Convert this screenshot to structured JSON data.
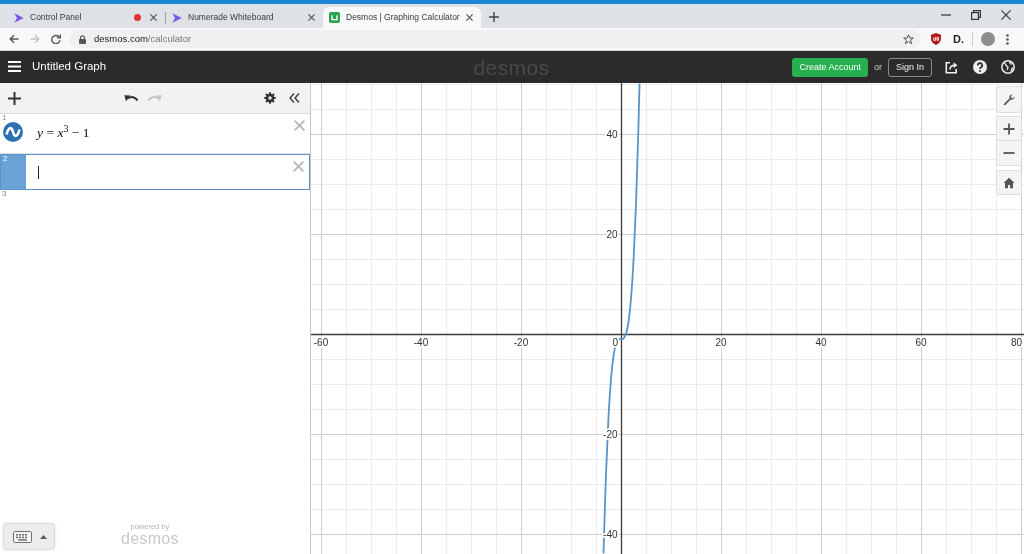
{
  "browser": {
    "tabs": [
      {
        "title": "Control Panel",
        "recording": true,
        "selected": false
      },
      {
        "title": "Numerade Whiteboard",
        "recording": false,
        "selected": false
      },
      {
        "title": "Desmos | Graphing Calculator",
        "recording": false,
        "selected": true
      }
    ],
    "nav_buttons": [
      {
        "kind": "back",
        "disabled": false
      },
      {
        "kind": "forward",
        "disabled": true
      },
      {
        "kind": "reload",
        "disabled": false
      }
    ],
    "address": {
      "host": "desmos.com",
      "path": "/calculator"
    },
    "extension_label": "D."
  },
  "header": {
    "graph_title": "Untitled Graph",
    "logo": "desmos",
    "create_account": "Create Account",
    "separator": "or",
    "sign_in": "Sign In"
  },
  "expression_list": {
    "history_buttons": [
      {
        "kind": "undo",
        "disabled": false
      },
      {
        "kind": "redo",
        "disabled": true
      }
    ],
    "items": [
      {
        "kind": "expression",
        "index": "1",
        "formula": "*y* = *x*$^{3}$ − 1",
        "color": "#2d70b3",
        "selected": false
      },
      {
        "kind": "expression",
        "index": "2",
        "selected": true
      },
      {
        "kind": "new",
        "index": "3",
        "selected": false
      }
    ],
    "footer": {
      "caption": "powered by",
      "logo": "desmos"
    }
  },
  "graph": {
    "chart_data": {
      "type": "line",
      "grid": true,
      "xlim": [
        -62,
        80.6
      ],
      "ylim": [
        -44,
        50.2
      ],
      "xticks": [
        -60,
        -40,
        -20,
        0,
        20,
        40,
        60,
        80
      ],
      "yticks": [
        -40,
        -20,
        20,
        40
      ],
      "x": [
        -3.5,
        -3,
        -2.5,
        -2,
        -1.5,
        -1,
        -0.5,
        0,
        0.5,
        1,
        1.5,
        2,
        2.5,
        3,
        3.5,
        3.71
      ],
      "series": [
        {
          "color": "#5b93c7",
          "values": [
            -43.9,
            -28,
            -16.6,
            -9,
            -4.4,
            -2,
            -1.1,
            -1,
            -0.9,
            0,
            2.4,
            7,
            14.6,
            26,
            41.9,
            50.1
          ]
        }
      ]
    }
  }
}
